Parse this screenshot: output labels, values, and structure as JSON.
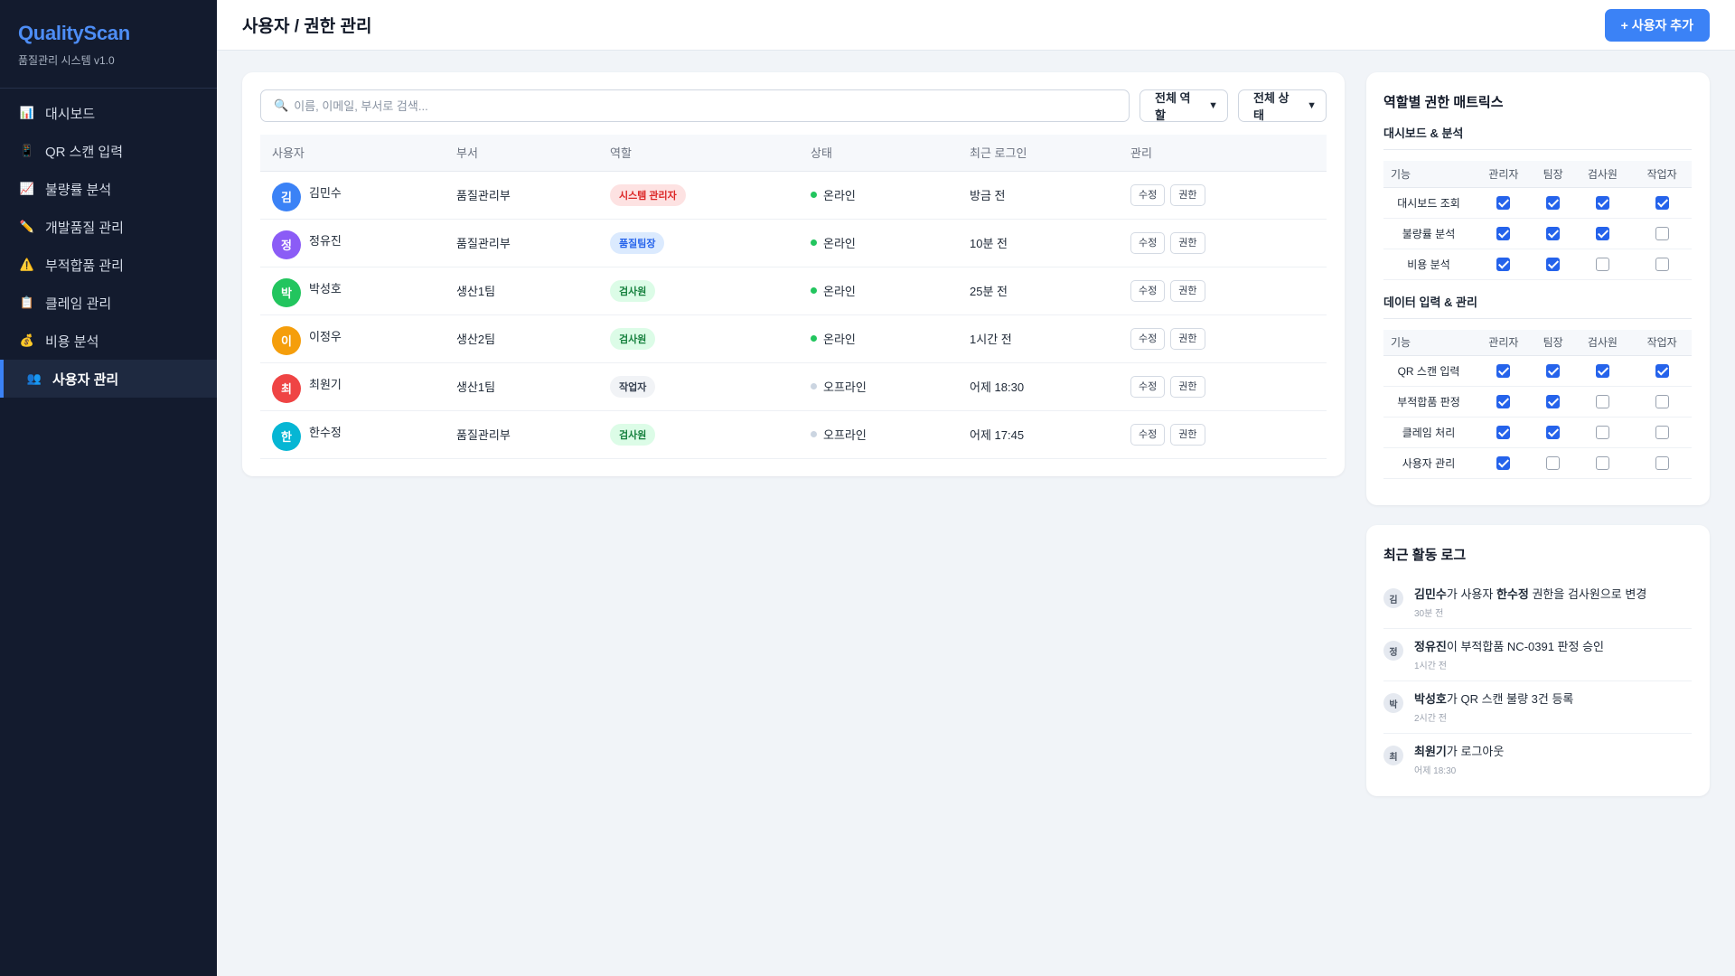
{
  "app": {
    "title": "QualityScan",
    "subtitle": "품질관리 시스템 v1.0"
  },
  "sidebar": {
    "items": [
      {
        "label": "대시보드",
        "icon": "bar-chart-icon",
        "glyph": "📊"
      },
      {
        "label": "QR 스캔 입력",
        "icon": "phone-icon",
        "glyph": "📱"
      },
      {
        "label": "불량률 분석",
        "icon": "trend-chart-icon",
        "glyph": "📈"
      },
      {
        "label": "개발품질 관리",
        "icon": "pencil-icon",
        "glyph": "✏️"
      },
      {
        "label": "부적합품 관리",
        "icon": "warning-icon",
        "glyph": "⚠️"
      },
      {
        "label": "클레임 관리",
        "icon": "clipboard-icon",
        "glyph": "📋"
      },
      {
        "label": "비용 분석",
        "icon": "money-bag-icon",
        "glyph": "💰"
      },
      {
        "label": "사용자 관리",
        "icon": "users-icon",
        "glyph": "👥",
        "active": true
      }
    ]
  },
  "header": {
    "title": "사용자 / 권한 관리",
    "add_button": "+ 사용자 추가"
  },
  "filters": {
    "search_placeholder": "이름, 이메일, 부서로 검색...",
    "search_icon": "search-icon",
    "role_select": "전체 역할",
    "status_select": "전체 상태"
  },
  "users_table": {
    "columns": [
      "사용자",
      "부서",
      "역할",
      "상태",
      "최근 로그인",
      "관리"
    ],
    "edit_label": "수정",
    "perm_label": "권한",
    "rows": [
      {
        "initial": "김",
        "name": "김민수",
        "dept": "품질관리부",
        "role": "시스템 관리자",
        "role_bg": "#fde2e2",
        "role_color": "#dc2626",
        "status": "온라인",
        "status_color": "#22c55e",
        "last_login": "방금 전",
        "avatar_color": "#3b82f6"
      },
      {
        "initial": "정",
        "name": "정유진",
        "dept": "품질관리부",
        "role": "품질팀장",
        "role_bg": "#dbeafe",
        "role_color": "#2563eb",
        "status": "온라인",
        "status_color": "#22c55e",
        "last_login": "10분 전",
        "avatar_color": "#8b5cf6"
      },
      {
        "initial": "박",
        "name": "박성호",
        "dept": "생산1팀",
        "role": "검사원",
        "role_bg": "#dcfce7",
        "role_color": "#15803d",
        "status": "온라인",
        "status_color": "#22c55e",
        "last_login": "25분 전",
        "avatar_color": "#22c55e"
      },
      {
        "initial": "이",
        "name": "이정우",
        "dept": "생산2팀",
        "role": "검사원",
        "role_bg": "#dcfce7",
        "role_color": "#15803d",
        "status": "온라인",
        "status_color": "#22c55e",
        "last_login": "1시간 전",
        "avatar_color": "#f59e0b"
      },
      {
        "initial": "최",
        "name": "최원기",
        "dept": "생산1팀",
        "role": "작업자",
        "role_bg": "#f1f3f6",
        "role_color": "#374151",
        "status": "오프라인",
        "status_color": "#cbd5e1",
        "last_login": "어제 18:30",
        "avatar_color": "#ef4444"
      },
      {
        "initial": "한",
        "name": "한수정",
        "dept": "품질관리부",
        "role": "검사원",
        "role_bg": "#dcfce7",
        "role_color": "#15803d",
        "status": "오프라인",
        "status_color": "#cbd5e1",
        "last_login": "어제 17:45",
        "avatar_color": "#06b6d4"
      }
    ]
  },
  "permissions": {
    "title": "역할별 권한 매트릭스",
    "columns": [
      "기능",
      "관리자",
      "팀장",
      "검사원",
      "작업자"
    ],
    "sections": [
      {
        "title": "대시보드 & 분석",
        "rows": [
          {
            "feature": "대시보드 조회",
            "values": [
              true,
              true,
              true,
              true
            ]
          },
          {
            "feature": "불량률 분석",
            "values": [
              true,
              true,
              true,
              false
            ]
          },
          {
            "feature": "비용 분석",
            "values": [
              true,
              true,
              false,
              false
            ]
          }
        ]
      },
      {
        "title": "데이터 입력 & 관리",
        "rows": [
          {
            "feature": "QR 스캔 입력",
            "values": [
              true,
              true,
              true,
              true
            ]
          },
          {
            "feature": "부적합품 판정",
            "values": [
              true,
              true,
              false,
              false
            ]
          },
          {
            "feature": "클레임 처리",
            "values": [
              true,
              true,
              false,
              false
            ]
          },
          {
            "feature": "사용자 관리",
            "values": [
              true,
              false,
              false,
              false
            ]
          }
        ]
      }
    ]
  },
  "activity": {
    "title": "최근 활동 로그",
    "items": [
      {
        "initial": "김",
        "parts": [
          {
            "t": "김민수",
            "b": true
          },
          {
            "t": "가 사용자 "
          },
          {
            "t": "한수정",
            "b": true
          },
          {
            "t": " 권한을 검사원으로 변경"
          }
        ],
        "time": "30분 전"
      },
      {
        "initial": "정",
        "parts": [
          {
            "t": "정유진",
            "b": true
          },
          {
            "t": "이 부적합품 NC-0391 판정 승인"
          }
        ],
        "time": "1시간 전"
      },
      {
        "initial": "박",
        "parts": [
          {
            "t": "박성호",
            "b": true
          },
          {
            "t": "가 QR 스캔 불량 3건 등록"
          }
        ],
        "time": "2시간 전"
      },
      {
        "initial": "최",
        "parts": [
          {
            "t": "최원기",
            "b": true
          },
          {
            "t": "가 로그아웃"
          }
        ],
        "time": "어제 18:30"
      }
    ]
  }
}
